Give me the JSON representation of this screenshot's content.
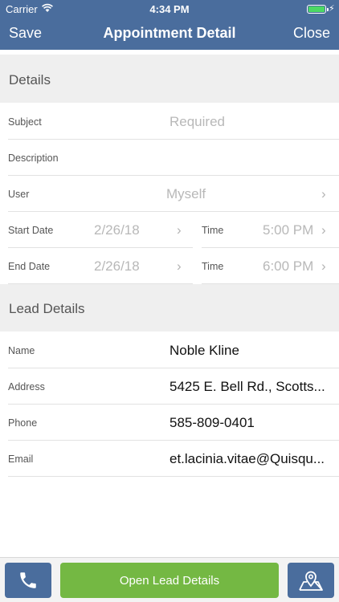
{
  "status_bar": {
    "carrier": "Carrier",
    "time": "4:34 PM"
  },
  "nav": {
    "save": "Save",
    "title": "Appointment Detail",
    "close": "Close"
  },
  "details": {
    "header": "Details",
    "subject": {
      "label": "Subject",
      "placeholder": "Required"
    },
    "description": {
      "label": "Description",
      "value": ""
    },
    "user": {
      "label": "User",
      "value": "Myself"
    },
    "start": {
      "date_label": "Start Date",
      "date_value": "2/26/18",
      "time_label": "Time",
      "time_value": "5:00 PM"
    },
    "end": {
      "date_label": "End Date",
      "date_value": "2/26/18",
      "time_label": "Time",
      "time_value": "6:00 PM"
    }
  },
  "lead": {
    "header": "Lead Details",
    "name": {
      "label": "Name",
      "value": "Noble Kline"
    },
    "address": {
      "label": "Address",
      "value": "5425 E. Bell Rd., Scotts..."
    },
    "phone": {
      "label": "Phone",
      "value": "585-809-0401"
    },
    "email": {
      "label": "Email",
      "value": "et.lacinia.vitae@Quisqu..."
    }
  },
  "bottom": {
    "phone_icon": "phone-icon",
    "open_label": "Open Lead Details",
    "map_icon": "map-pin-icon"
  },
  "colors": {
    "nav": "#4a6d9d",
    "accent_green": "#74b843",
    "battery": "#4cd964"
  }
}
